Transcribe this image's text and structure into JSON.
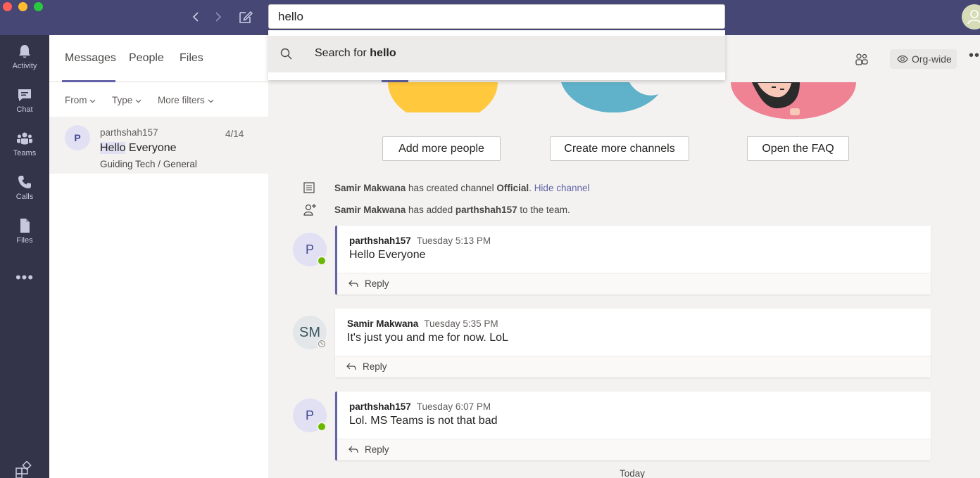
{
  "titlebar": {
    "search_value": "hello",
    "search_suggestion_prefix": "Search for",
    "search_suggestion_term": "hello"
  },
  "appbar": {
    "items": [
      {
        "label": "Activity",
        "icon": "bell-icon"
      },
      {
        "label": "Chat",
        "icon": "chat-icon"
      },
      {
        "label": "Teams",
        "icon": "teams-icon"
      },
      {
        "label": "Calls",
        "icon": "phone-icon"
      },
      {
        "label": "Files",
        "icon": "file-icon"
      }
    ],
    "more": "•••"
  },
  "leftpanel": {
    "tabs": [
      "Messages",
      "People",
      "Files"
    ],
    "filters": [
      "From",
      "Type",
      "More filters"
    ],
    "result": {
      "avatar": "P",
      "author": "parthshah157",
      "date": "4/14",
      "text_highlight": "Hello",
      "text_rest": " Everyone",
      "channel": "Guiding Tech / General"
    }
  },
  "main": {
    "org_label": "Org-wide",
    "more": "•••",
    "cta": [
      "Add more people",
      "Create more channels",
      "Open the FAQ"
    ],
    "system": [
      {
        "actor": "Samir Makwana",
        "mid": " has created channel ",
        "object": "Official",
        "end": ".",
        "link": "Hide channel"
      },
      {
        "actor": "Samir Makwana",
        "mid": " has added ",
        "object": "parthshah157",
        "end": " to the team."
      }
    ],
    "messages": [
      {
        "avatar": "P",
        "author": "parthshah157",
        "time": "Tuesday 5:13 PM",
        "body": "Hello Everyone",
        "reply": "Reply"
      },
      {
        "avatar": "SM",
        "author": "Samir Makwana",
        "time": "Tuesday 5:35 PM",
        "body": "It's just you and me for now. LoL",
        "reply": "Reply"
      },
      {
        "avatar": "P",
        "author": "parthshah157",
        "time": "Tuesday 6:07 PM",
        "body": "Lol. MS Teams is not that bad",
        "reply": "Reply"
      }
    ],
    "today": "Today"
  },
  "colors": {
    "titlebar": "#464775",
    "appbar": "#33344a",
    "accent": "#6264a7",
    "presence_available": "#6bb700"
  }
}
